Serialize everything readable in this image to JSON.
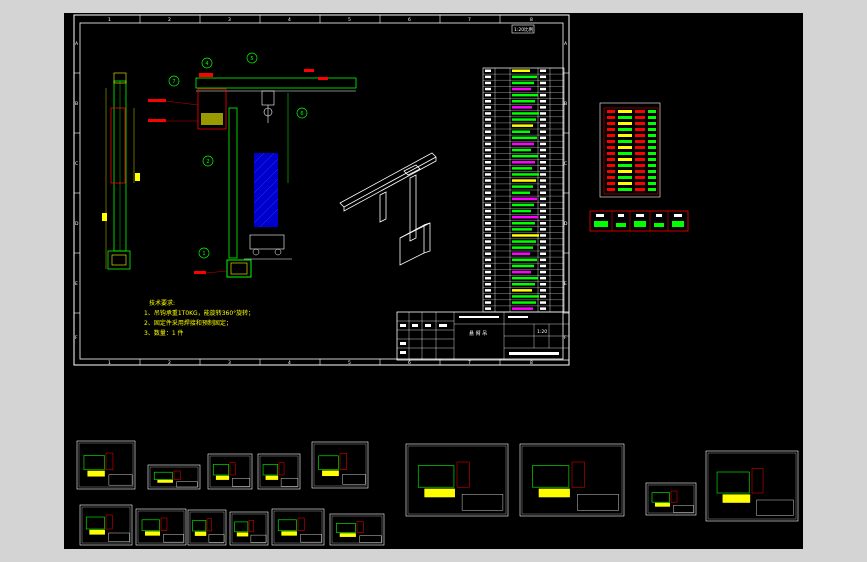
{
  "main_sheet": {
    "border_numbers_top": [
      "1",
      "2",
      "3",
      "4",
      "5",
      "6",
      "7",
      "8"
    ],
    "border_numbers_bottom": [
      "1",
      "2",
      "3",
      "4",
      "5",
      "6",
      "7",
      "8"
    ],
    "border_letters_left": [
      "A",
      "B",
      "C",
      "D",
      "E",
      "F"
    ],
    "border_letters_right": [
      "A",
      "B",
      "C",
      "D",
      "E",
      "F"
    ],
    "corner_tag": "1:20比例",
    "balloons": [
      "1",
      "2",
      "3",
      "4",
      "5",
      "6",
      "7"
    ],
    "tech_requirements": {
      "title": "技术要求:",
      "lines": [
        "1、吊钩承重1T0KG，能旋转360°旋转；",
        "2、固定件采用焊接和预制固定；",
        "3、数量：1 件"
      ]
    },
    "title_block_name": "悬 臂 吊",
    "title_block_scale": "1:20"
  },
  "colors": {
    "background": "#000000",
    "frame": "#ffffff",
    "geometry": "#00ff00",
    "annotation": "#ff0000",
    "text": "#ffff00",
    "hatch": "#0000ff",
    "accent": "#ff00ff"
  },
  "icons": [
    "drawing-sheet-icon",
    "isometric-view-icon",
    "thumbnail-sheet-icon"
  ]
}
